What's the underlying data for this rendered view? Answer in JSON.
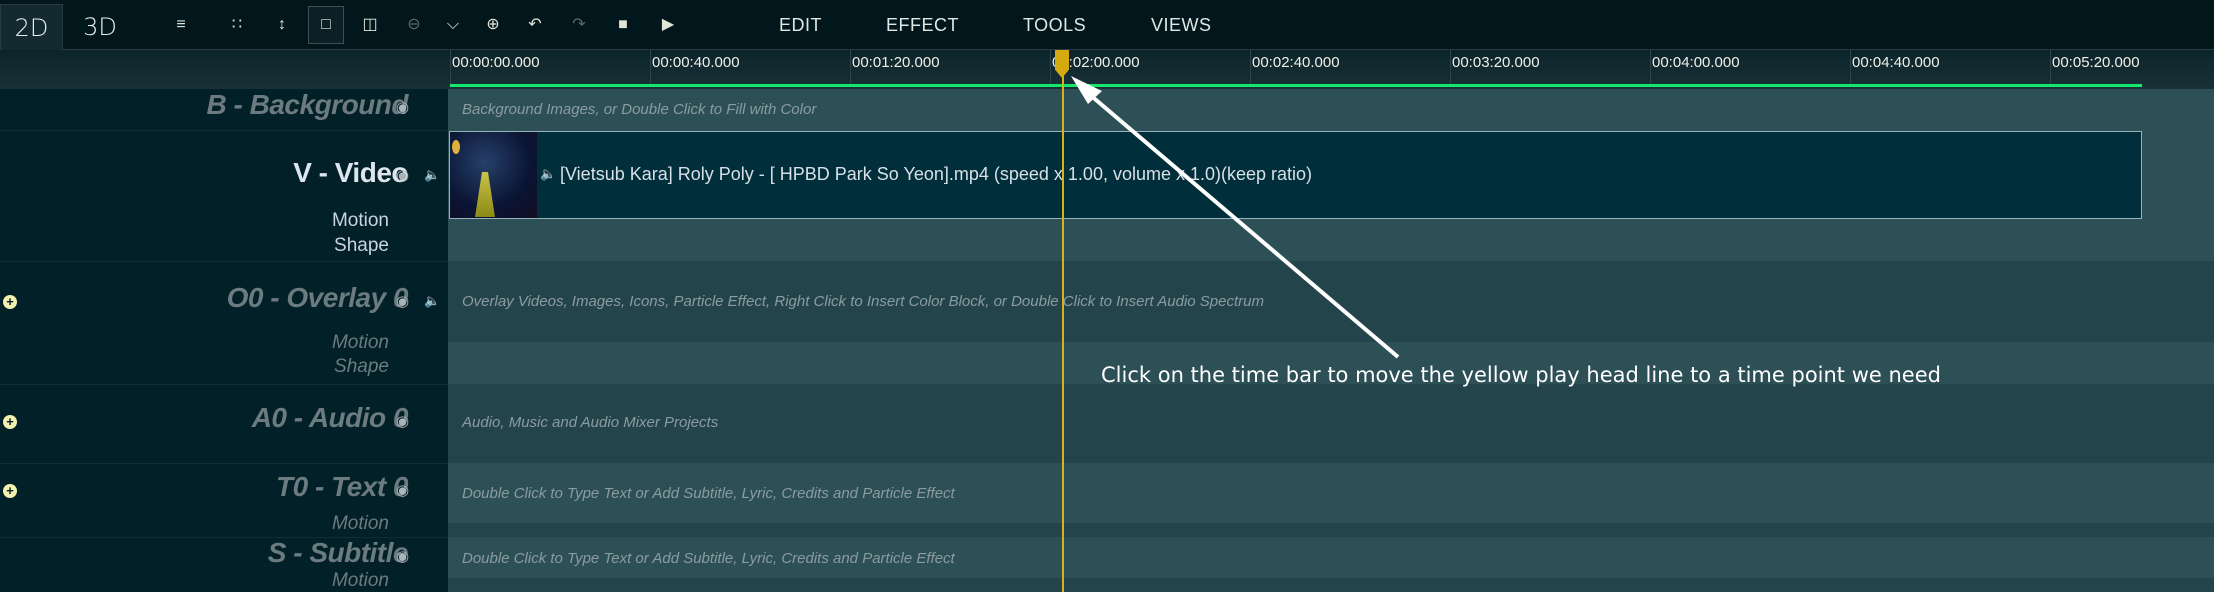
{
  "toolbar": {
    "tabs": [
      {
        "label": "2D",
        "active": true
      },
      {
        "label": "3D",
        "active": false
      }
    ],
    "tools": [
      "align-tracks-icon",
      "grid-icon",
      "vertical-resize-icon",
      "fit-icon",
      "split-icon",
      "zoom-out-icon",
      "ruler-icon",
      "zoom-in-icon",
      "undo-icon",
      "redo-icon",
      "stop-icon",
      "play-icon"
    ],
    "menus": [
      "EDIT",
      "EFFECT",
      "TOOLS",
      "VIEWS"
    ]
  },
  "ruler": {
    "ticks": [
      "00:00:00.000",
      "00:00:40.000",
      "00:01:20.000",
      "00:02:00.000",
      "00:02:40.000",
      "00:03:20.000",
      "00:04:00.000",
      "00:04:40.000",
      "00:05:20.000"
    ]
  },
  "tracks": {
    "background": {
      "label": "B - Background",
      "hint": "Background Images, or Double Click to Fill with Color"
    },
    "video": {
      "label": "V - Video",
      "motion": "Motion",
      "shape": "Shape",
      "clip": "[Vietsub Kara] Roly Poly - [ HPBD Park So Yeon].mp4  (speed x 1.00, volume x 1.0)(keep ratio)"
    },
    "overlay": {
      "label": "O0 - Overlay 0",
      "hint": "Overlay Videos, Images, Icons, Particle Effect, Right Click to Insert Color Block, or Double Click to Insert Audio Spectrum",
      "motion": "Motion",
      "shape": "Shape"
    },
    "audio": {
      "label": "A0 - Audio 0",
      "hint": "Audio, Music and Audio Mixer Projects"
    },
    "text": {
      "label": "T0 - Text 0",
      "hint": "Double Click to Type Text or Add Subtitle, Lyric, Credits and Particle Effect",
      "motion": "Motion"
    },
    "subtitle": {
      "label": "S - Subtitle",
      "hint": "Double Click to Type Text or Add Subtitle, Lyric, Credits and Particle Effect",
      "motion": "Motion"
    }
  },
  "annotation": "Click on the time bar to move the yellow play head line to a time point we need",
  "colors": {
    "playhead": "#d8b21a",
    "progress": "#13e86a",
    "accent_plus": "#f4f0b0"
  }
}
